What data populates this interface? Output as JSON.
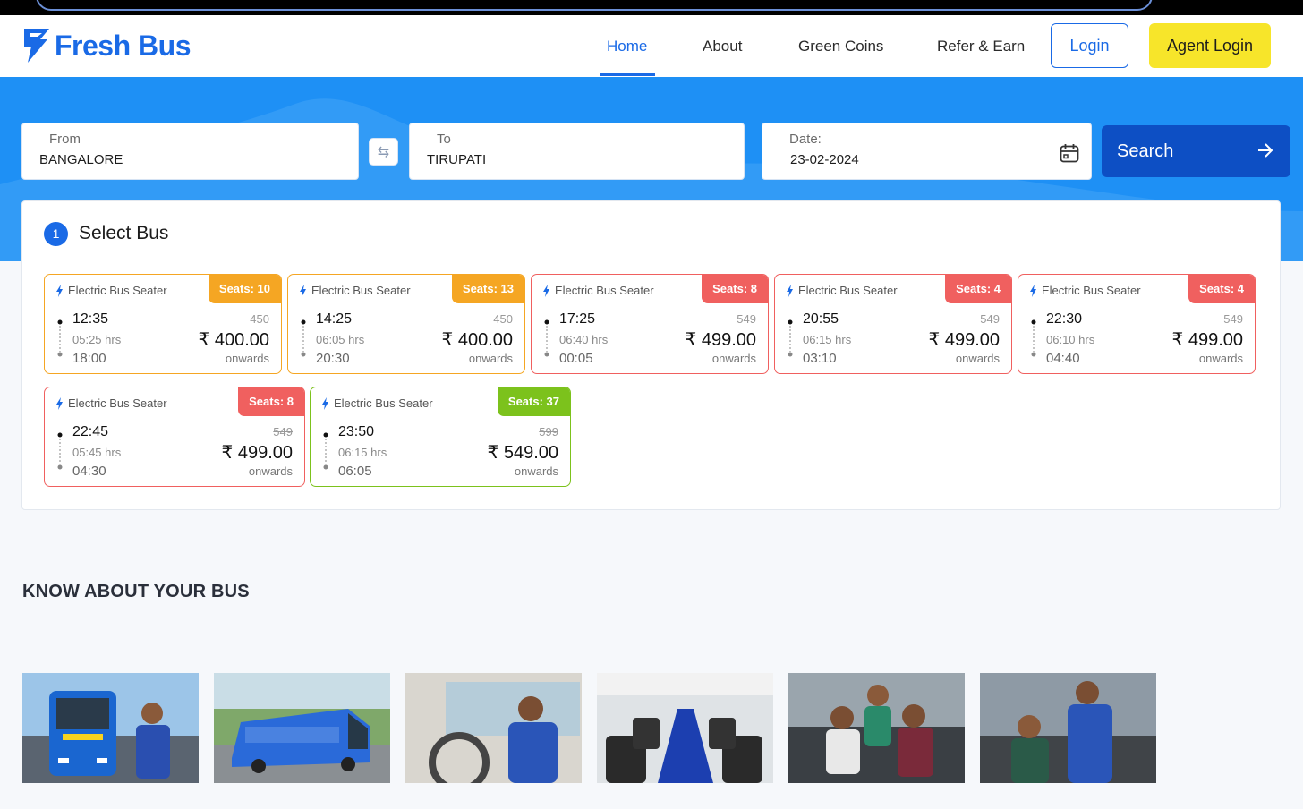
{
  "brand": {
    "name": "Fresh Bus",
    "color": "#1a6ae6"
  },
  "nav": {
    "items": [
      {
        "label": "Home",
        "active": true
      },
      {
        "label": "About",
        "active": false
      },
      {
        "label": "Green Coins",
        "active": false
      },
      {
        "label": "Refer & Earn",
        "active": false
      }
    ],
    "login_label": "Login",
    "agent_login_label": "Agent Login"
  },
  "search": {
    "from_label": "From",
    "from_value": "BANGALORE",
    "to_label": "To",
    "to_value": "TIRUPATI",
    "date_label": "Date:",
    "date_value": "23-02-2024",
    "button_label": "Search",
    "swap_icon": "swap-arrows-icon"
  },
  "select_bus": {
    "step": "1",
    "title": "Select Bus",
    "buses": [
      {
        "type": "Electric Bus Seater",
        "seats": "Seats:  10",
        "status": "orange",
        "departure": "12:35",
        "duration": "05:25 hrs",
        "arrival": "18:00",
        "old_price": "450",
        "price": "₹ 400.00",
        "note": "onwards"
      },
      {
        "type": "Electric Bus Seater",
        "seats": "Seats:  13",
        "status": "orange",
        "departure": "14:25",
        "duration": "06:05 hrs",
        "arrival": "20:30",
        "old_price": "450",
        "price": "₹ 400.00",
        "note": "onwards"
      },
      {
        "type": "Electric Bus Seater",
        "seats": "Seats:  8",
        "status": "red",
        "departure": "17:25",
        "duration": "06:40 hrs",
        "arrival": "00:05",
        "old_price": "549",
        "price": "₹ 499.00",
        "note": "onwards"
      },
      {
        "type": "Electric Bus Seater",
        "seats": "Seats:  4",
        "status": "red",
        "departure": "20:55",
        "duration": "06:15 hrs",
        "arrival": "03:10",
        "old_price": "549",
        "price": "₹ 499.00",
        "note": "onwards"
      },
      {
        "type": "Electric Bus Seater",
        "seats": "Seats:  4",
        "status": "red",
        "departure": "22:30",
        "duration": "06:10 hrs",
        "arrival": "04:40",
        "old_price": "549",
        "price": "₹ 499.00",
        "note": "onwards"
      },
      {
        "type": "Electric Bus Seater",
        "seats": "Seats:  8",
        "status": "red",
        "departure": "22:45",
        "duration": "05:45 hrs",
        "arrival": "04:30",
        "old_price": "549",
        "price": "₹ 499.00",
        "note": "onwards"
      },
      {
        "type": "Electric Bus Seater",
        "seats": "Seats:  37",
        "status": "green",
        "departure": "23:50",
        "duration": "06:15 hrs",
        "arrival": "06:05",
        "old_price": "599",
        "price": "₹ 549.00",
        "note": "onwards"
      }
    ]
  },
  "know": {
    "title": "KNOW ABOUT YOUR BUS",
    "photos": [
      "bus-front-with-driver-photo",
      "blue-bus-on-road-photo",
      "driver-at-wheel-photo",
      "bus-interior-seats-photo",
      "passengers-in-bus-photo",
      "conductor-assisting-passenger-photo"
    ]
  },
  "colors": {
    "hero": "#1e90f5",
    "search_button": "#0d4fc4",
    "agent_button": "#f7e52a",
    "seats_orange": "#f5a623",
    "seats_red": "#f0605f",
    "seats_green": "#7cc21c"
  }
}
